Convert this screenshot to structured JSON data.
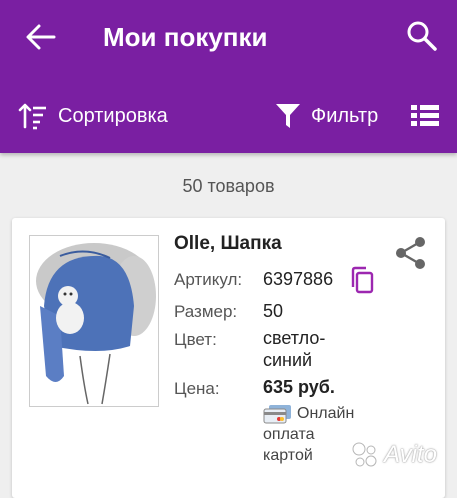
{
  "header": {
    "title": "Мои покупки",
    "sort_label": "Сортировка",
    "filter_label": "Фильтр"
  },
  "results": {
    "count_text": "50 товаров"
  },
  "product": {
    "title": "Olle, Шапка",
    "article_label": "Артикул:",
    "article_value": "6397886",
    "size_label": "Размер:",
    "size_value": "50",
    "color_label": "Цвет:",
    "color_value_line1": "светло-",
    "color_value_line2": "синий",
    "price_label": "Цена:",
    "price_value": "635 руб.",
    "payment_line1": "Онлайн",
    "payment_line2": "оплата",
    "payment_line3": "картой"
  },
  "watermark": {
    "text": "Avito"
  },
  "colors": {
    "appbar": "#7a1fa2",
    "accent": "#9c27b0",
    "background": "#efefef"
  },
  "icons": [
    "arrow-back-icon",
    "search-icon",
    "sort-icon",
    "filter-icon",
    "list-view-icon",
    "share-icon",
    "copy-icon",
    "credit-card-icon"
  ]
}
